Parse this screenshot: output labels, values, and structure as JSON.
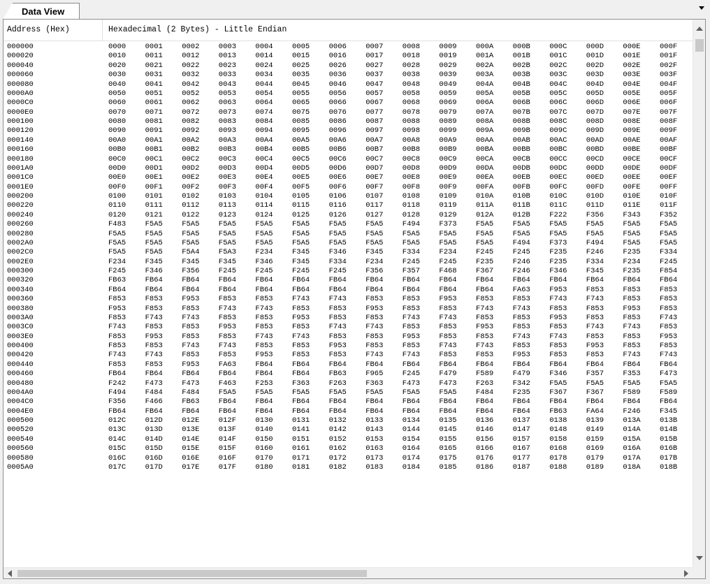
{
  "tab": {
    "label": "Data View"
  },
  "columns": {
    "address": "Address (Hex)",
    "data": "Hexadecimal (2 Bytes) - Little Endian"
  },
  "rows": [
    {
      "address": "000000",
      "values": [
        "0000",
        "0001",
        "0002",
        "0003",
        "0004",
        "0005",
        "0006",
        "0007",
        "0008",
        "0009",
        "000A",
        "000B",
        "000C",
        "000D",
        "000E",
        "000F"
      ]
    },
    {
      "address": "000020",
      "values": [
        "0010",
        "0011",
        "0012",
        "0013",
        "0014",
        "0015",
        "0016",
        "0017",
        "0018",
        "0019",
        "001A",
        "001B",
        "001C",
        "001D",
        "001E",
        "001F"
      ]
    },
    {
      "address": "000040",
      "values": [
        "0020",
        "0021",
        "0022",
        "0023",
        "0024",
        "0025",
        "0026",
        "0027",
        "0028",
        "0029",
        "002A",
        "002B",
        "002C",
        "002D",
        "002E",
        "002F"
      ]
    },
    {
      "address": "000060",
      "values": [
        "0030",
        "0031",
        "0032",
        "0033",
        "0034",
        "0035",
        "0036",
        "0037",
        "0038",
        "0039",
        "003A",
        "003B",
        "003C",
        "003D",
        "003E",
        "003F"
      ]
    },
    {
      "address": "000080",
      "values": [
        "0040",
        "0041",
        "0042",
        "0043",
        "0044",
        "0045",
        "0046",
        "0047",
        "0048",
        "0049",
        "004A",
        "004B",
        "004C",
        "004D",
        "004E",
        "004F"
      ]
    },
    {
      "address": "0000A0",
      "values": [
        "0050",
        "0051",
        "0052",
        "0053",
        "0054",
        "0055",
        "0056",
        "0057",
        "0058",
        "0059",
        "005A",
        "005B",
        "005C",
        "005D",
        "005E",
        "005F"
      ]
    },
    {
      "address": "0000C0",
      "values": [
        "0060",
        "0061",
        "0062",
        "0063",
        "0064",
        "0065",
        "0066",
        "0067",
        "0068",
        "0069",
        "006A",
        "006B",
        "006C",
        "006D",
        "006E",
        "006F"
      ]
    },
    {
      "address": "0000E0",
      "values": [
        "0070",
        "0071",
        "0072",
        "0073",
        "0074",
        "0075",
        "0076",
        "0077",
        "0078",
        "0079",
        "007A",
        "007B",
        "007C",
        "007D",
        "007E",
        "007F"
      ]
    },
    {
      "address": "000100",
      "values": [
        "0080",
        "0081",
        "0082",
        "0083",
        "0084",
        "0085",
        "0086",
        "0087",
        "0088",
        "0089",
        "008A",
        "008B",
        "008C",
        "008D",
        "008E",
        "008F"
      ]
    },
    {
      "address": "000120",
      "values": [
        "0090",
        "0091",
        "0092",
        "0093",
        "0094",
        "0095",
        "0096",
        "0097",
        "0098",
        "0099",
        "009A",
        "009B",
        "009C",
        "009D",
        "009E",
        "009F"
      ]
    },
    {
      "address": "000140",
      "values": [
        "00A0",
        "00A1",
        "00A2",
        "00A3",
        "00A4",
        "00A5",
        "00A6",
        "00A7",
        "00A8",
        "00A9",
        "00AA",
        "00AB",
        "00AC",
        "00AD",
        "00AE",
        "00AF"
      ]
    },
    {
      "address": "000160",
      "values": [
        "00B0",
        "00B1",
        "00B2",
        "00B3",
        "00B4",
        "00B5",
        "00B6",
        "00B7",
        "00B8",
        "00B9",
        "00BA",
        "00BB",
        "00BC",
        "00BD",
        "00BE",
        "00BF"
      ]
    },
    {
      "address": "000180",
      "values": [
        "00C0",
        "00C1",
        "00C2",
        "00C3",
        "00C4",
        "00C5",
        "00C6",
        "00C7",
        "00C8",
        "00C9",
        "00CA",
        "00CB",
        "00CC",
        "00CD",
        "00CE",
        "00CF"
      ]
    },
    {
      "address": "0001A0",
      "values": [
        "00D0",
        "00D1",
        "00D2",
        "00D3",
        "00D4",
        "00D5",
        "00D6",
        "00D7",
        "00D8",
        "00D9",
        "00DA",
        "00DB",
        "00DC",
        "00DD",
        "00DE",
        "00DF"
      ]
    },
    {
      "address": "0001C0",
      "values": [
        "00E0",
        "00E1",
        "00E2",
        "00E3",
        "00E4",
        "00E5",
        "00E6",
        "00E7",
        "00E8",
        "00E9",
        "00EA",
        "00EB",
        "00EC",
        "00ED",
        "00EE",
        "00EF"
      ]
    },
    {
      "address": "0001E0",
      "values": [
        "00F0",
        "00F1",
        "00F2",
        "00F3",
        "00F4",
        "00F5",
        "00F6",
        "00F7",
        "00F8",
        "00F9",
        "00FA",
        "00FB",
        "00FC",
        "00FD",
        "00FE",
        "00FF"
      ]
    },
    {
      "address": "000200",
      "values": [
        "0100",
        "0101",
        "0102",
        "0103",
        "0104",
        "0105",
        "0106",
        "0107",
        "0108",
        "0109",
        "010A",
        "010B",
        "010C",
        "010D",
        "010E",
        "010F"
      ]
    },
    {
      "address": "000220",
      "values": [
        "0110",
        "0111",
        "0112",
        "0113",
        "0114",
        "0115",
        "0116",
        "0117",
        "0118",
        "0119",
        "011A",
        "011B",
        "011C",
        "011D",
        "011E",
        "011F"
      ]
    },
    {
      "address": "000240",
      "values": [
        "0120",
        "0121",
        "0122",
        "0123",
        "0124",
        "0125",
        "0126",
        "0127",
        "0128",
        "0129",
        "012A",
        "012B",
        "F222",
        "F356",
        "F343",
        "F352"
      ]
    },
    {
      "address": "000260",
      "values": [
        "F483",
        "F5A5",
        "F5A5",
        "F5A5",
        "F5A5",
        "F5A5",
        "F5A5",
        "F5A5",
        "F494",
        "F373",
        "F5A5",
        "F5A5",
        "F5A5",
        "F5A5",
        "F5A5",
        "F5A5"
      ]
    },
    {
      "address": "000280",
      "values": [
        "F5A5",
        "F5A5",
        "F5A5",
        "F5A5",
        "F5A5",
        "F5A5",
        "F5A5",
        "F5A5",
        "F5A5",
        "F5A5",
        "F5A5",
        "F5A5",
        "F5A5",
        "F5A5",
        "F5A5",
        "F5A5"
      ]
    },
    {
      "address": "0002A0",
      "values": [
        "F5A5",
        "F5A5",
        "F5A5",
        "F5A5",
        "F5A5",
        "F5A5",
        "F5A5",
        "F5A5",
        "F5A5",
        "F5A5",
        "F5A5",
        "F494",
        "F373",
        "F494",
        "F5A5",
        "F5A5"
      ]
    },
    {
      "address": "0002C0",
      "values": [
        "F5A5",
        "F5A5",
        "F5A4",
        "F5A3",
        "F234",
        "F345",
        "F346",
        "F345",
        "F334",
        "F234",
        "F245",
        "F245",
        "F235",
        "F246",
        "F235",
        "F334"
      ]
    },
    {
      "address": "0002E0",
      "values": [
        "F234",
        "F345",
        "F345",
        "F345",
        "F346",
        "F345",
        "F334",
        "F234",
        "F245",
        "F245",
        "F235",
        "F246",
        "F235",
        "F334",
        "F234",
        "F245"
      ]
    },
    {
      "address": "000300",
      "values": [
        "F245",
        "F346",
        "F356",
        "F245",
        "F245",
        "F245",
        "F245",
        "F356",
        "F357",
        "F468",
        "F367",
        "F246",
        "F346",
        "F345",
        "F235",
        "F854"
      ]
    },
    {
      "address": "000320",
      "values": [
        "FB63",
        "FB64",
        "FB64",
        "FB64",
        "FB64",
        "FB64",
        "FB64",
        "FB64",
        "FB64",
        "FB64",
        "FB64",
        "FB64",
        "FB64",
        "FB64",
        "FB64",
        "FB64"
      ]
    },
    {
      "address": "000340",
      "values": [
        "FB64",
        "FB64",
        "FB64",
        "FB64",
        "FB64",
        "FB64",
        "FB64",
        "FB64",
        "FB64",
        "FB64",
        "FB64",
        "FA63",
        "F953",
        "F853",
        "F853",
        "F853"
      ]
    },
    {
      "address": "000360",
      "values": [
        "F853",
        "F853",
        "F953",
        "F853",
        "F853",
        "F743",
        "F743",
        "F853",
        "F853",
        "F953",
        "F853",
        "F853",
        "F743",
        "F743",
        "F853",
        "F853"
      ]
    },
    {
      "address": "000380",
      "values": [
        "F953",
        "F853",
        "F853",
        "F743",
        "F743",
        "F853",
        "F853",
        "F953",
        "F853",
        "F853",
        "F743",
        "F743",
        "F853",
        "F853",
        "F953",
        "F853"
      ]
    },
    {
      "address": "0003A0",
      "values": [
        "F853",
        "F743",
        "F743",
        "F853",
        "F853",
        "F953",
        "F853",
        "F853",
        "F743",
        "F743",
        "F853",
        "F853",
        "F953",
        "F853",
        "F853",
        "F743"
      ]
    },
    {
      "address": "0003C0",
      "values": [
        "F743",
        "F853",
        "F853",
        "F953",
        "F853",
        "F853",
        "F743",
        "F743",
        "F853",
        "F853",
        "F953",
        "F853",
        "F853",
        "F743",
        "F743",
        "F853"
      ]
    },
    {
      "address": "0003E0",
      "values": [
        "F853",
        "F953",
        "F853",
        "F853",
        "F743",
        "F743",
        "F853",
        "F853",
        "F953",
        "F853",
        "F853",
        "F743",
        "F743",
        "F853",
        "F853",
        "F953"
      ]
    },
    {
      "address": "000400",
      "values": [
        "F853",
        "F853",
        "F743",
        "F743",
        "F853",
        "F853",
        "F953",
        "F853",
        "F853",
        "F743",
        "F743",
        "F853",
        "F853",
        "F953",
        "F853",
        "F853"
      ]
    },
    {
      "address": "000420",
      "values": [
        "F743",
        "F743",
        "F853",
        "F853",
        "F953",
        "F853",
        "F853",
        "F743",
        "F743",
        "F853",
        "F853",
        "F953",
        "F853",
        "F853",
        "F743",
        "F743"
      ]
    },
    {
      "address": "000440",
      "values": [
        "F853",
        "F853",
        "F953",
        "FA63",
        "FB64",
        "FB64",
        "FB64",
        "FB64",
        "FB64",
        "FB64",
        "FB64",
        "FB64",
        "FB64",
        "FB64",
        "FB64",
        "FB64"
      ]
    },
    {
      "address": "000460",
      "values": [
        "FB64",
        "FB64",
        "FB64",
        "FB64",
        "FB64",
        "FB64",
        "FB63",
        "F965",
        "F245",
        "F479",
        "F589",
        "F479",
        "F346",
        "F357",
        "F353",
        "F473"
      ]
    },
    {
      "address": "000480",
      "values": [
        "F242",
        "F473",
        "F473",
        "F463",
        "F253",
        "F363",
        "F263",
        "F363",
        "F473",
        "F473",
        "F263",
        "F342",
        "F5A5",
        "F5A5",
        "F5A5",
        "F5A5"
      ]
    },
    {
      "address": "0004A0",
      "values": [
        "F494",
        "F484",
        "F484",
        "F5A5",
        "F5A5",
        "F5A5",
        "F5A5",
        "F5A5",
        "F5A5",
        "F5A5",
        "F484",
        "F235",
        "F367",
        "F367",
        "F589",
        "F589"
      ]
    },
    {
      "address": "0004C0",
      "values": [
        "F356",
        "F466",
        "FB63",
        "FB64",
        "FB64",
        "FB64",
        "FB64",
        "FB64",
        "FB64",
        "FB64",
        "FB64",
        "FB64",
        "FB64",
        "FB64",
        "FB64",
        "FB64"
      ]
    },
    {
      "address": "0004E0",
      "values": [
        "FB64",
        "FB64",
        "FB64",
        "FB64",
        "FB64",
        "FB64",
        "FB64",
        "FB64",
        "FB64",
        "FB64",
        "FB64",
        "FB64",
        "FB63",
        "FA64",
        "F246",
        "F345"
      ]
    },
    {
      "address": "000500",
      "values": [
        "012C",
        "012D",
        "012E",
        "012F",
        "0130",
        "0131",
        "0132",
        "0133",
        "0134",
        "0135",
        "0136",
        "0137",
        "0138",
        "0139",
        "013A",
        "013B"
      ]
    },
    {
      "address": "000520",
      "values": [
        "013C",
        "013D",
        "013E",
        "013F",
        "0140",
        "0141",
        "0142",
        "0143",
        "0144",
        "0145",
        "0146",
        "0147",
        "0148",
        "0149",
        "014A",
        "014B"
      ]
    },
    {
      "address": "000540",
      "values": [
        "014C",
        "014D",
        "014E",
        "014F",
        "0150",
        "0151",
        "0152",
        "0153",
        "0154",
        "0155",
        "0156",
        "0157",
        "0158",
        "0159",
        "015A",
        "015B"
      ]
    },
    {
      "address": "000560",
      "values": [
        "015C",
        "015D",
        "015E",
        "015F",
        "0160",
        "0161",
        "0162",
        "0163",
        "0164",
        "0165",
        "0166",
        "0167",
        "0168",
        "0169",
        "016A",
        "016B"
      ]
    },
    {
      "address": "000580",
      "values": [
        "016C",
        "016D",
        "016E",
        "016F",
        "0170",
        "0171",
        "0172",
        "0173",
        "0174",
        "0175",
        "0176",
        "0177",
        "0178",
        "0179",
        "017A",
        "017B"
      ]
    },
    {
      "address": "0005A0",
      "values": [
        "017C",
        "017D",
        "017E",
        "017F",
        "0180",
        "0181",
        "0182",
        "0183",
        "0184",
        "0185",
        "0186",
        "0187",
        "0188",
        "0189",
        "018A",
        "018B"
      ]
    }
  ]
}
